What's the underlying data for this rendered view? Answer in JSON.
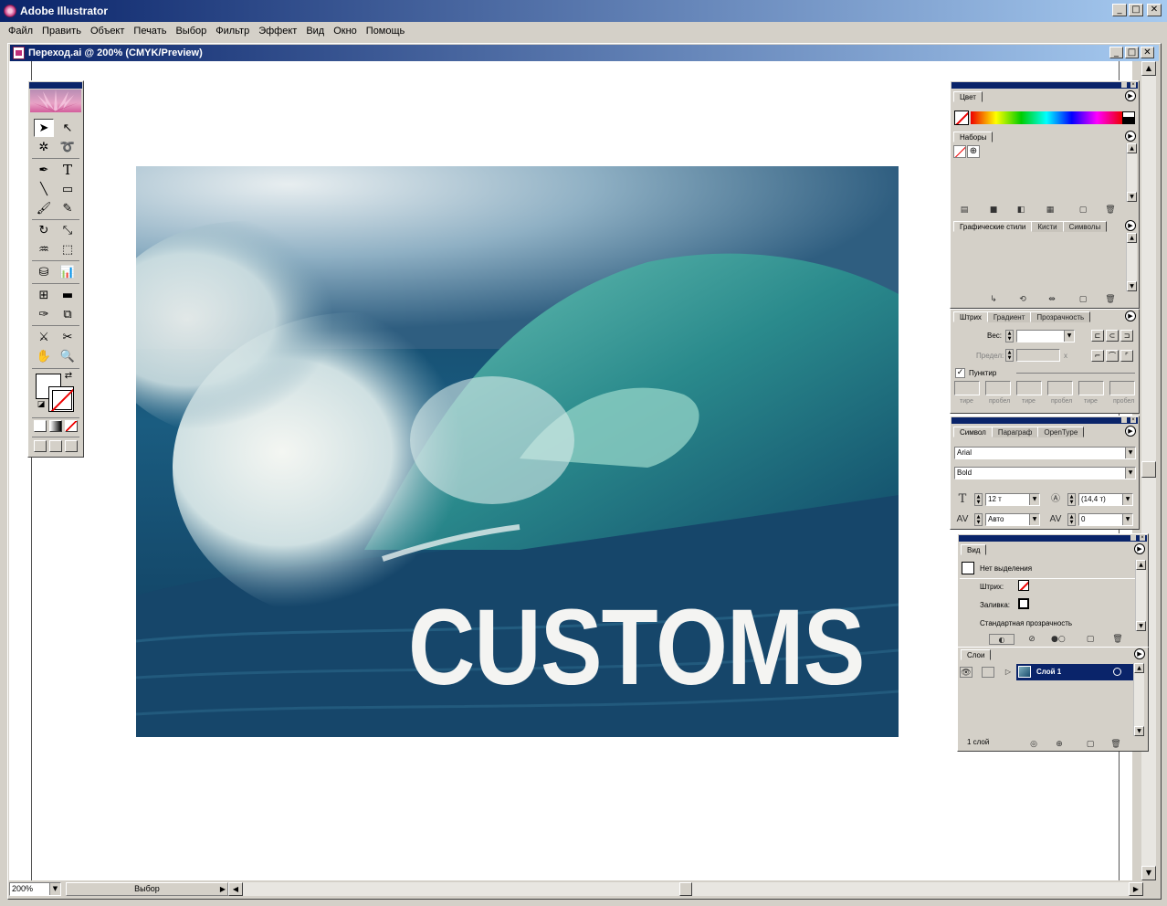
{
  "app": {
    "title": "Adobe Illustrator"
  },
  "menu": [
    "Файл",
    "Править",
    "Объект",
    "Печать",
    "Выбор",
    "Фильтр",
    "Эффект",
    "Вид",
    "Окно",
    "Помощь"
  ],
  "document": {
    "title": "Переход.ai @ 200% (CMYK/Preview)"
  },
  "artwork": {
    "headline": "CUSTOMS",
    "image": "ocean-wave-photo"
  },
  "status": {
    "zoom": "200%",
    "tool_status": "Выбор"
  },
  "panels": {
    "color": {
      "tab": "Цвет"
    },
    "swatches": {
      "tab": "Наборы"
    },
    "styles": {
      "tabs": [
        "Графические стили",
        "Кисти",
        "Символы"
      ]
    },
    "stroke": {
      "tabs": [
        "Штрих",
        "Градиент",
        "Прозрачность"
      ],
      "weight_label": "Вес:",
      "limit_label": "Предел:",
      "limit_unit": "x",
      "dashed_label": "Пунктир",
      "dash_labels": [
        "тире",
        "пробел",
        "тире",
        "пробел",
        "тире",
        "пробел"
      ]
    },
    "character": {
      "tabs": [
        "Символ",
        "Параграф",
        "OpenType"
      ],
      "font": "Arial",
      "style": "Bold",
      "size": "12 т",
      "leading": "(14,4 т)",
      "kerning": "Авто",
      "tracking": "0"
    },
    "appearance": {
      "tab": "Вид",
      "no_selection": "Нет выделения",
      "stroke_label": "Штрих:",
      "fill_label": "Заливка:",
      "transparency": "Стандартная прозрачность"
    },
    "layers": {
      "tab": "Слои",
      "layer_name": "Слой 1",
      "count": "1 слой"
    }
  },
  "colors": {
    "title_dark": "#0a246a",
    "title_light": "#a6caf0",
    "chrome": "#d4d0c8",
    "selection": "#0a246a"
  }
}
